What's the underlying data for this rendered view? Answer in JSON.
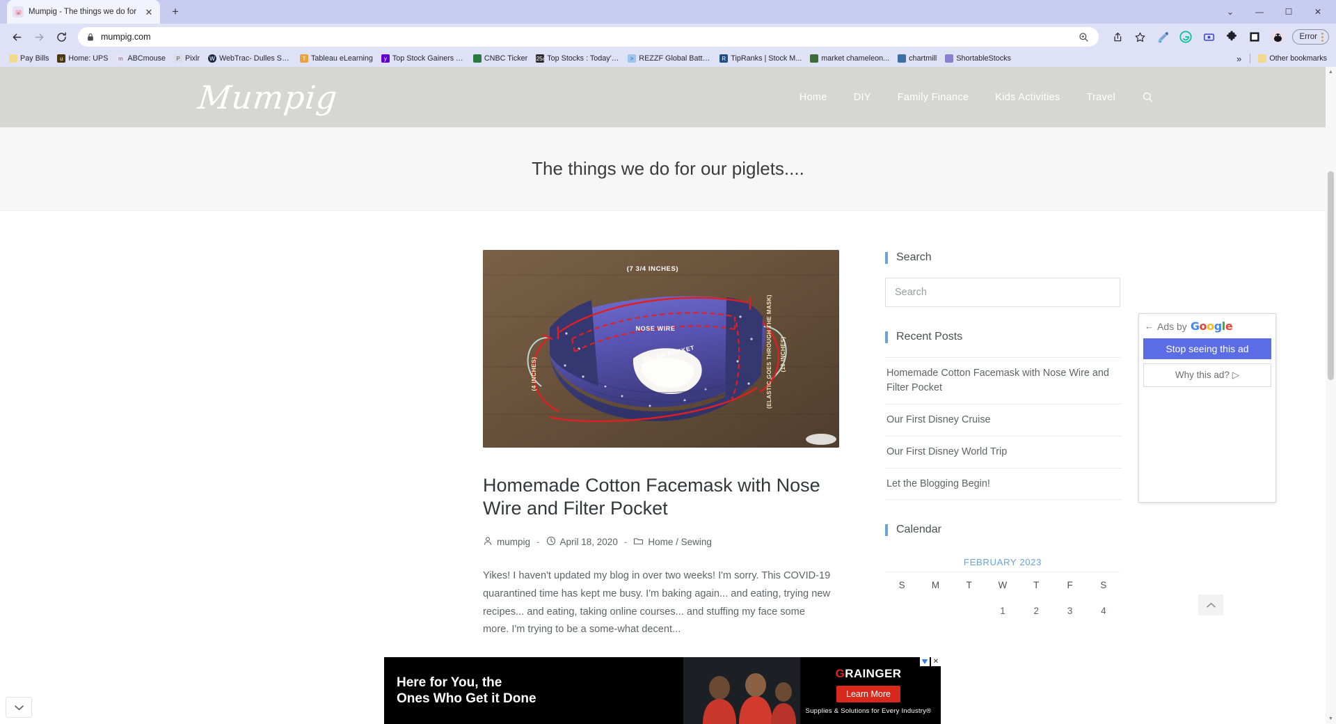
{
  "browser": {
    "tab": {
      "title": "Mumpig - The things we do for o",
      "favicon": "mumpig-favicon",
      "close_label": "✕"
    },
    "new_tab_label": "+",
    "window_controls": {
      "minimize": "—",
      "maximize": "☐",
      "close": "✕",
      "chevron": "⌄"
    },
    "nav": {
      "back": "←",
      "forward": "→",
      "reload": "↻"
    },
    "omnibox": {
      "url": "mumpig.com",
      "lock_icon": "lock-icon",
      "zoom_icon": "zoom-in-icon",
      "share_icon": "share-icon",
      "bookmark_icon": "star-icon"
    },
    "toolbar_icons": [
      {
        "name": "eyedropper-icon"
      },
      {
        "name": "grammarly-icon"
      },
      {
        "name": "extension-blue-icon"
      },
      {
        "name": "puzzle-extensions-icon"
      },
      {
        "name": "square-extension-icon"
      },
      {
        "name": "profile-avatar-icon"
      }
    ],
    "error_badge": {
      "label": "Error",
      "menu_icon": "kebab-menu-icon"
    },
    "bookmarks": [
      {
        "label": "Pay Bills",
        "icon": "folder-icon",
        "color": "#f3d98b"
      },
      {
        "label": "Home: UPS",
        "icon": "ups-icon",
        "color": "#3b2f13"
      },
      {
        "label": "ABCmouse",
        "icon": "abcmouse-icon",
        "color": "#e8e4f2"
      },
      {
        "label": "Pixlr",
        "icon": "pixlr-icon",
        "color": "#dcdce6"
      },
      {
        "label": "WebTrac- Dulles So...",
        "icon": "webtrac-icon",
        "color": "#1c2a4a"
      },
      {
        "label": "Tableau eLearning",
        "icon": "tableau-icon",
        "color": "#e8a33d"
      },
      {
        "label": "Top Stock Gainers T...",
        "icon": "yahoo-icon",
        "color": "#6001d2"
      },
      {
        "label": "CNBC Ticker",
        "icon": "cnbc-icon",
        "color": "#2b7a3d"
      },
      {
        "label": "Top Stocks : Today's...",
        "icon": "chart-icon",
        "color": "#2b2b2b"
      },
      {
        "label": "REZZF Global Batter...",
        "icon": "link-icon",
        "color": "#6ea8e8"
      },
      {
        "label": "TipRanks | Stock M...",
        "icon": "tipranks-icon",
        "color": "#1b4f8a"
      },
      {
        "label": "market chameleon...",
        "icon": "chameleon-icon",
        "color": "#3e6b3a"
      },
      {
        "label": "chartmill",
        "icon": "chartmill-icon",
        "color": "#3a6ea5"
      },
      {
        "label": "ShortableStocks",
        "icon": "shortablestocks-icon",
        "color": "#7b6fc4"
      }
    ],
    "bookmarks_overflow": "»",
    "other_bookmarks": {
      "label": "Other bookmarks",
      "icon": "folder-icon"
    }
  },
  "site": {
    "logo": "Mumpig",
    "nav": [
      {
        "label": "Home"
      },
      {
        "label": "DIY"
      },
      {
        "label": "Family Finance"
      },
      {
        "label": "Kids Activities"
      },
      {
        "label": "Travel"
      }
    ],
    "search_icon": "search-icon",
    "tagline": "The things we do for our piglets...."
  },
  "post": {
    "image": {
      "alt": "homemade-cotton-facemask-photo",
      "annotations": {
        "top_width": "(7 3/4 INCHES)",
        "nose_wire": "NOSE WIRE",
        "filter_pocket": "FILTER POCKET",
        "left_height": "(4 INCHES)",
        "elastic": "(ELASTIC GOES THROUGH THE MASK)",
        "elastic_length": "(10 INCHES)"
      }
    },
    "title": "Homemade Cotton Facemask with Nose Wire and Filter Pocket",
    "author": "mumpig",
    "author_icon": "person-icon",
    "date": "April 18, 2020",
    "date_icon": "clock-icon",
    "category": "Home / Sewing",
    "category_icon": "folder-icon",
    "separator": "-",
    "excerpt": "Yikes! I haven't updated my blog in over two weeks! I'm sorry. This COVID-19 quarantined time has kept me busy. I'm baking again... and eating, trying new recipes... and eating, taking online courses... and stuffing my face some more. I'm trying to be a some-what decent..."
  },
  "sidebar": {
    "search": {
      "title": "Search",
      "placeholder": "Search",
      "value": ""
    },
    "recent": {
      "title": "Recent Posts",
      "items": [
        {
          "label": "Homemade Cotton Facemask with Nose Wire and Filter Pocket"
        },
        {
          "label": "Our First Disney Cruise"
        },
        {
          "label": "Our First Disney World Trip"
        },
        {
          "label": "Let the Blogging Begin!"
        }
      ]
    },
    "calendar": {
      "title": "Calendar",
      "month": "FEBRUARY 2023",
      "weekdays": [
        "S",
        "M",
        "T",
        "W",
        "T",
        "F",
        "S"
      ],
      "weeks": [
        [
          "",
          "",
          "",
          "1",
          "2",
          "3",
          "4"
        ]
      ]
    },
    "accent_color": "#6ba3d6"
  },
  "ad_panel": {
    "back_icon": "back-arrow-icon",
    "ads_by": "Ads by",
    "brand": "Google",
    "stop_label": "Stop seeing this ad",
    "why_label": "Why this ad?",
    "why_icon": "adchoices-icon",
    "button_color": "#5b6ce4"
  },
  "bottom_ad": {
    "line1": "Here for You, the",
    "line2": "Ones Who Get it Done",
    "brand_g": "G",
    "brand_rest": "RAINGER",
    "cta": "Learn More",
    "tagline": "Supplies & Solutions for Every Industry®",
    "close_label": "✕",
    "adchoices_icon": "adchoices-icon"
  },
  "controls": {
    "scroll_top_icon": "chevron-up-icon",
    "collapse_icon": "chevron-down-icon"
  }
}
